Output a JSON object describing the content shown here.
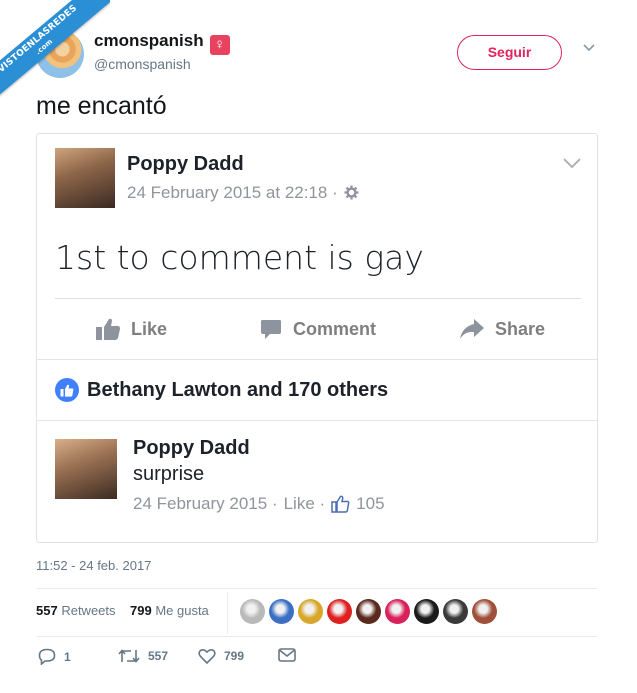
{
  "watermark": {
    "text": "VISTOENLASREDES",
    "sub": ".com"
  },
  "user": {
    "name": "cmonspanish",
    "handle": "@cmonspanish",
    "badge": "♀"
  },
  "follow_label": "Seguir",
  "tweet_text": "me encantó",
  "fb_post": {
    "author": "Poppy Dadd",
    "date": "24 February 2015 at 22:18 ·",
    "text": "1st to comment is gay",
    "actions": {
      "like": "Like",
      "comment": "Comment",
      "share": "Share"
    },
    "likes_text": "Bethany Lawton and 170 others",
    "comment": {
      "author": "Poppy Dadd",
      "text": "surprise",
      "date": "24 February 2015 ·",
      "like_label": "Like ·",
      "like_count": "105"
    }
  },
  "timestamp": "11:52 - 24 feb. 2017",
  "stats": {
    "retweets_count": "557",
    "retweets_label": "Retweets",
    "likes_count": "799",
    "likes_label": "Me gusta"
  },
  "liker_faces": [
    "#b9b9b9",
    "#3a6fc4",
    "#d8a72a",
    "#e02020",
    "#5a2a1e",
    "#d8205a",
    "#1a1a1a",
    "#3a3a3a",
    "#a0503a"
  ],
  "bottom_actions": {
    "replies": "1",
    "retweets": "557",
    "likes": "799"
  },
  "colors": {
    "follow": "#e0245e",
    "fb_blue": "#4080ff",
    "watermark": "#2b8fd6"
  }
}
